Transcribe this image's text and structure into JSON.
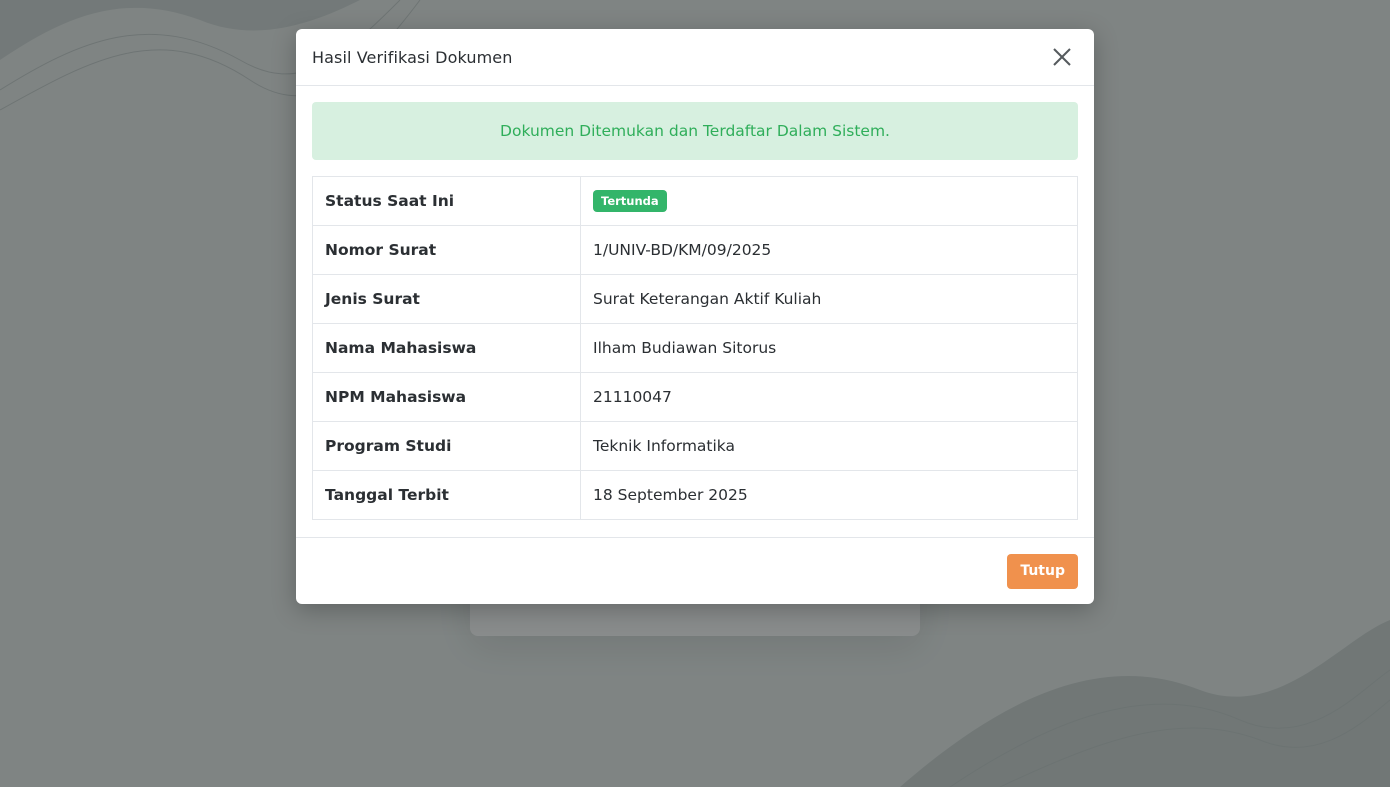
{
  "modal": {
    "title": "Hasil Verifikasi Dokumen",
    "close_icon": "close-icon",
    "alert_text": "Dokumen Ditemukan dan Terdaftar Dalam Sistem.",
    "footer_button": "Tutup"
  },
  "details": {
    "status": {
      "label": "Status Saat Ini",
      "value": "Tertunda"
    },
    "rows": [
      {
        "label": "Nomor Surat",
        "value": "1/UNIV-BD/KM/09/2025"
      },
      {
        "label": "Jenis Surat",
        "value": "Surat Keterangan Aktif Kuliah"
      },
      {
        "label": "Nama Mahasiswa",
        "value": "Ilham Budiawan Sitorus"
      },
      {
        "label": "NPM Mahasiswa",
        "value": "21110047"
      },
      {
        "label": "Program Studi",
        "value": "Teknik Informatika"
      },
      {
        "label": "Tanggal Terbit",
        "value": "18 September 2025"
      }
    ]
  },
  "colors": {
    "alert_bg": "#d7f0e0",
    "alert_text": "#2fae5a",
    "badge": "#33b56a",
    "button": "#f0914d",
    "backdrop": "rgba(40,45,45,0.55)"
  }
}
